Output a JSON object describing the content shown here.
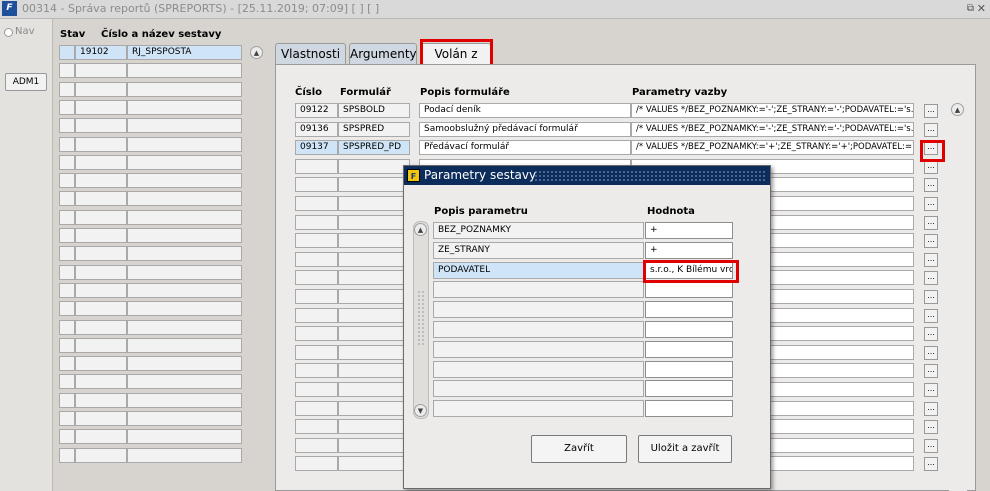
{
  "window": {
    "logo": "F",
    "title": "00314 - Správa reportů (SPREPORTS) - [25.11.2019; 07:09]  [ ]  [ ]",
    "restore_glyph": "⧉",
    "close_glyph": "✕"
  },
  "left_panel": {
    "nav_label": "Nav",
    "adm_button": "ADM1"
  },
  "reports_grid": {
    "headers": {
      "stav": "Stav",
      "cislo_nazev": "Číslo a název sestavy"
    },
    "rows": [
      {
        "cislo": "19102",
        "nazev": "RJ_SPSPOSTA",
        "selected": true
      }
    ],
    "empty_rows": 22
  },
  "tabs": [
    {
      "label": "Vlastnosti",
      "active": false
    },
    {
      "label": "Argumenty",
      "active": false
    },
    {
      "label": "Volán z",
      "active": true
    }
  ],
  "forms_table": {
    "headers": {
      "cislo": "Číslo",
      "formular": "Formulář",
      "popis": "Popis formuláře",
      "parametry": "Parametry vazby"
    },
    "rows": [
      {
        "cislo": "09122",
        "formular": "SPSBOLD",
        "popis": "Podací deník",
        "parametry": "/* VALUES */BEZ_POZNAMKY:='-';ZE_STRANY:='-';PODAVATEL:='s.r.o., K Bílému vrchu'",
        "selected": false
      },
      {
        "cislo": "09136",
        "formular": "SPSPRED",
        "popis": "Samoobslužný předávací formulář",
        "parametry": "/* VALUES */BEZ_POZNAMKY:='-';ZE_STRANY:='-';PODAVATEL:='s.r.o., K Bílému vrchu'",
        "selected": false
      },
      {
        "cislo": "09137",
        "formular": "SPSPRED_PD",
        "popis": "Předávací formulář",
        "parametry": "/* VALUES */BEZ_POZNAMKY:='+';ZE_STRANY:='+';PODAVATEL:='s.r.o., K Bílému vrchu'",
        "selected": true
      }
    ],
    "dots_label": "...",
    "empty_rows": 17
  },
  "dialog": {
    "icon": "F",
    "title": "Parametry sestavy",
    "headers": {
      "popis": "Popis parametru",
      "hodnota": "Hodnota"
    },
    "rows": [
      {
        "popis": "BEZ_POZNAMKY",
        "hodnota": "+",
        "selected": false
      },
      {
        "popis": "ZE_STRANY",
        "hodnota": "+",
        "selected": false
      },
      {
        "popis": "PODAVATEL",
        "hodnota": "s.r.o., K Bílému vrchu",
        "selected": true
      }
    ],
    "empty_rows": 7,
    "close_button": "Zavřít",
    "save_close_button": "Uložit a zavřít"
  }
}
